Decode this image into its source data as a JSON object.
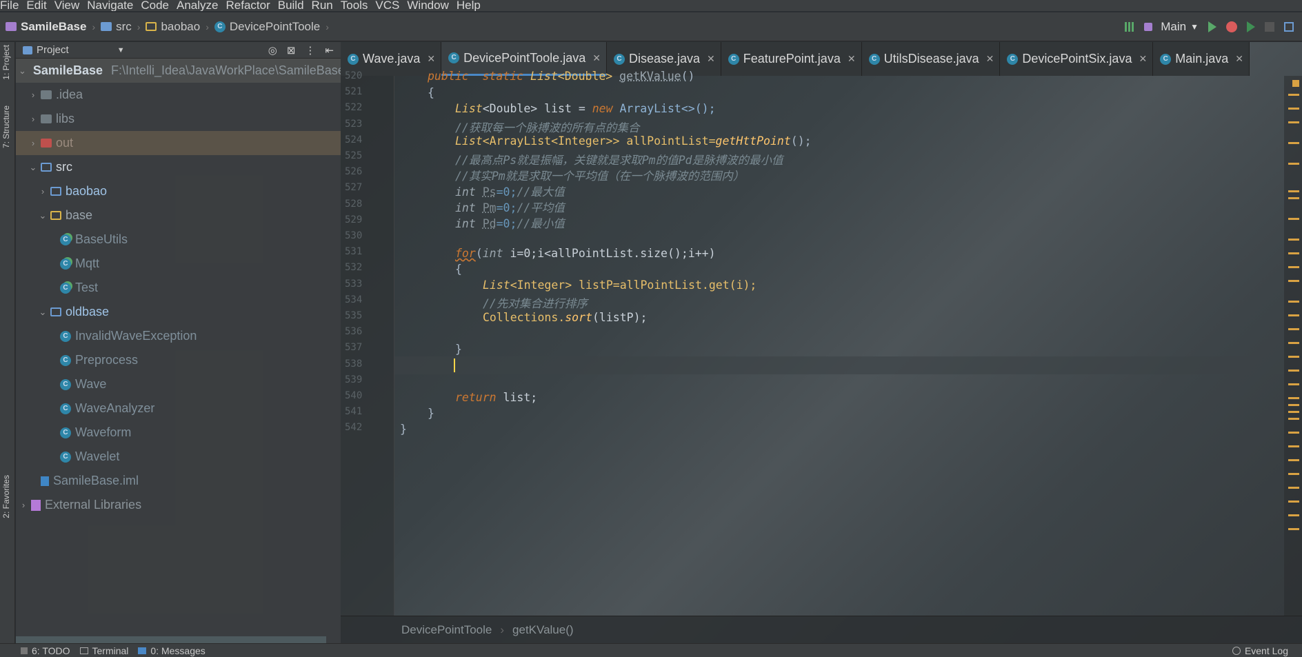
{
  "menu": [
    "File",
    "Edit",
    "View",
    "Navigate",
    "Code",
    "Analyze",
    "Refactor",
    "Build",
    "Run",
    "Tools",
    "VCS",
    "Window",
    "Help"
  ],
  "breadcrumb": [
    "SamileBase",
    "src",
    "baobao",
    "DevicePointToole"
  ],
  "run_config": "Main",
  "left_tabs": [
    "1: Project",
    "7: Structure",
    "2: Favorites"
  ],
  "project": {
    "title": "Project",
    "tree": [
      {
        "label": "SamileBase",
        "extra": "F:\\Intelli_Idea\\JavaWorkPlace\\SamileBase",
        "kind": "module",
        "indent": 0,
        "expanded": true
      },
      {
        "label": ".idea",
        "kind": "folder-dim",
        "indent": 1
      },
      {
        "label": "libs",
        "kind": "folder-dim",
        "indent": 1
      },
      {
        "label": "out",
        "kind": "folder-red",
        "indent": 1
      },
      {
        "label": "src",
        "kind": "folder-blue",
        "indent": 1,
        "expanded": true
      },
      {
        "label": "baobao",
        "kind": "package",
        "indent": 2
      },
      {
        "label": "base",
        "kind": "package-open",
        "indent": 2,
        "expanded": true
      },
      {
        "label": "BaseUtils",
        "kind": "class-run",
        "indent": 3
      },
      {
        "label": "Mqtt",
        "kind": "class-run",
        "indent": 3
      },
      {
        "label": "Test",
        "kind": "class-run",
        "indent": 3
      },
      {
        "label": "oldbase",
        "kind": "package",
        "indent": 2,
        "expanded": true
      },
      {
        "label": "InvalidWaveException",
        "kind": "class",
        "indent": 3
      },
      {
        "label": "Preprocess",
        "kind": "class",
        "indent": 3
      },
      {
        "label": "Wave",
        "kind": "class",
        "indent": 3
      },
      {
        "label": "WaveAnalyzer",
        "kind": "class",
        "indent": 3
      },
      {
        "label": "Waveform",
        "kind": "class",
        "indent": 3
      },
      {
        "label": "Wavelet",
        "kind": "class",
        "indent": 3
      },
      {
        "label": "SamileBase.iml",
        "kind": "iml",
        "indent": 1
      },
      {
        "label": "External Libraries",
        "kind": "libs",
        "indent": 0
      }
    ]
  },
  "tabs": [
    {
      "label": "Wave.java",
      "active": false
    },
    {
      "label": "DevicePointToole.java",
      "active": true
    },
    {
      "label": "Disease.java",
      "active": false
    },
    {
      "label": "FeaturePoint.java",
      "active": false
    },
    {
      "label": "UtilsDisease.java",
      "active": false
    },
    {
      "label": "DevicePointSix.java",
      "active": false
    },
    {
      "label": "Main.java",
      "active": false
    }
  ],
  "line_numbers": [
    "520",
    "521",
    "522",
    "523",
    "524",
    "525",
    "526",
    "527",
    "528",
    "529",
    "530",
    "531",
    "532",
    "533",
    "534",
    "535",
    "536",
    "537",
    "538",
    "539",
    "540",
    "541",
    "542"
  ],
  "code": {
    "l520_mod": "public  static ",
    "l520_type": "List",
    "l520_gen": "<Double> ",
    "l520_fn": "getKValue",
    "l520_end": "()",
    "l521": "{",
    "l522_a": "List",
    "l522_b": "<Double> list = ",
    "l522_new": "new ",
    "l522_c": "ArrayList<>();",
    "l523": "//获取每一个脉搏波的所有点的集合",
    "l524_a": "List",
    "l524_b": "<ArrayList<Integer>> allPointList=",
    "l524_fn": "getHttPoint",
    "l524_c": "();",
    "l525": "//最高点Ps就是振幅，关键就是求取Pm的值Pd是脉搏波的最小值",
    "l526": "//其实Pm就是求取一个平均值（在一个脉搏波的范围内）",
    "l527_kw": "int ",
    "l527_v": "Ps",
    "l527_n": "=0;",
    "l527_c": "//最大值",
    "l528_kw": "int ",
    "l528_v": "Pm",
    "l528_n": "=0;",
    "l528_c": "//平均值",
    "l529_kw": "int ",
    "l529_v": "Pd",
    "l529_n": "=0;",
    "l529_c": "//最小值",
    "l531_for": "for",
    "l531_a": "(",
    "l531_int": "int ",
    "l531_b": "i=0;i<allPointList.size();i++)",
    "l532": "{",
    "l533_a": "List",
    "l533_b": "<Integer> listP=allPointList.get(i);",
    "l534": "//先对集合进行排序",
    "l535_a": "Collections.",
    "l535_fn": "sort",
    "l535_b": "(listP);",
    "l537": "}",
    "l540_kw": "return ",
    "l540_b": "list;",
    "l541": "}",
    "l542": "}"
  },
  "editor_breadcrumb": [
    "DevicePointToole",
    "getKValue()"
  ],
  "status": {
    "todo": "6: TODO",
    "terminal": "Terminal",
    "messages": "0: Messages",
    "event_log": "Event Log"
  }
}
